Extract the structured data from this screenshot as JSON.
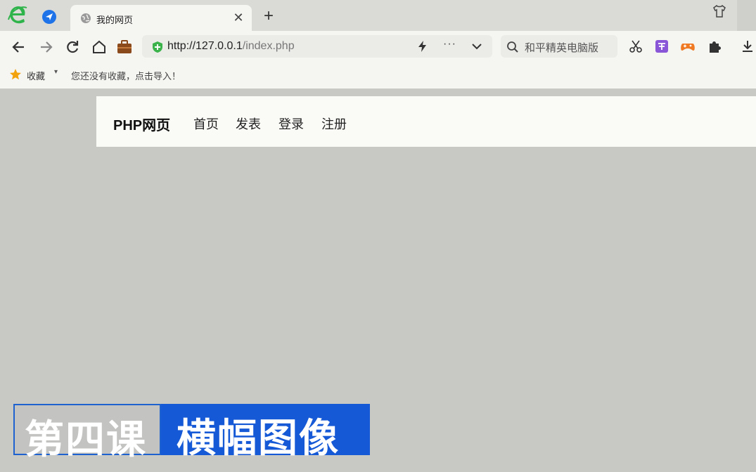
{
  "browser": {
    "tab": {
      "title": "我的网页",
      "close_label": "✕"
    },
    "new_tab_label": "+",
    "address": {
      "host": "http://127.0.0.1",
      "path": "/index.php"
    },
    "search": {
      "placeholder": "和平精英电脑版"
    },
    "more_label": "···",
    "bookmarks": {
      "label": "收藏",
      "caret": "▾",
      "hint": "您还没有收藏，点击导入！"
    },
    "accent": "#3cb34a"
  },
  "page": {
    "brand": "PHP网页",
    "nav": [
      "首页",
      "发表",
      "登录",
      "注册"
    ]
  },
  "banner": {
    "left": "第四课",
    "right": "横幅图像",
    "color": "#1559d6"
  }
}
